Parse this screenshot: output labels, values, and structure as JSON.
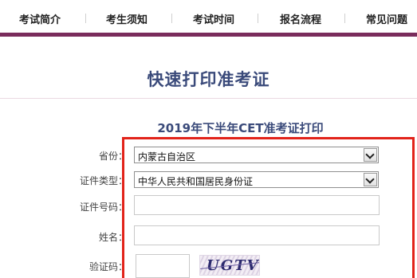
{
  "nav": {
    "items": [
      "考试简介",
      "考生须知",
      "考试时间",
      "报名流程",
      "常见问题"
    ],
    "accent": "#7a2c5c"
  },
  "page_title": "快速打印准考证",
  "form": {
    "title": "2019年下半年CET准考证打印",
    "highlight_color": "#e2231a",
    "province_label": "省份：",
    "province_value": "内蒙古自治区",
    "id_type_label": "证件类型：",
    "id_type_value": "中华人民共和国居民身份证",
    "id_number_label": "证件号码：",
    "id_number_value": "",
    "name_label": "姓名：",
    "name_value": "",
    "captcha_label": "验证码：",
    "captcha_value": "",
    "captcha_image_text": "UGTV"
  },
  "icons": {
    "select_arrow": "chevron-down-icon"
  }
}
